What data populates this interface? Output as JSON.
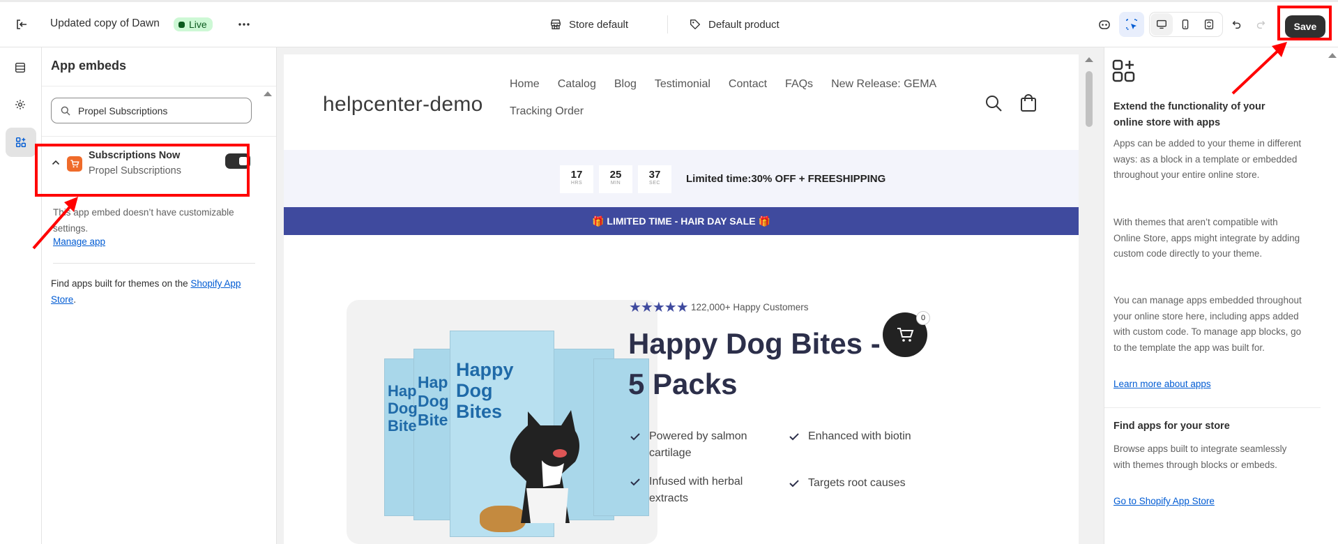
{
  "topbar": {
    "theme_name": "Updated copy of Dawn",
    "live_badge": "Live",
    "store_selector": "Store default",
    "template_selector": "Default product",
    "save_label": "Save"
  },
  "panel": {
    "title": "App embeds",
    "search_value": "Propel Subscriptions",
    "app": {
      "name": "Subscriptions Now",
      "subtitle": "Propel Subscriptions",
      "enabled": true,
      "note": "This app embed doesn’t have customizable settings.",
      "manage_link": "Manage app"
    },
    "footer_text": "Find apps built for themes on the ",
    "footer_link": "Shopify App Store",
    "footer_end": "."
  },
  "store": {
    "logo": "helpcenter-demo",
    "nav": [
      "Home",
      "Catalog",
      "Blog",
      "Testimonial",
      "Contact",
      "FAQs",
      "New Release: GEMA",
      "Tracking Order"
    ],
    "countdown": [
      {
        "value": "17",
        "unit": "HRS"
      },
      {
        "value": "25",
        "unit": "MIN"
      },
      {
        "value": "37",
        "unit": "SEC"
      }
    ],
    "promo_text": "Limited time:30% OFF + FREESHIPPING",
    "sale_banner": "🎁 LIMITED TIME - HAIR DAY SALE 🎁",
    "banner_color": "#3f4a9e",
    "stars": "★★★★★",
    "rating_text": "122,000+ Happy Customers",
    "product_title": "Happy Dog Bites - 5 Packs",
    "features": [
      "Powered by salmon cartilage",
      "Enhanced with biotin",
      "Infused with herbal extracts",
      "Targets root causes"
    ],
    "cart_count": "0",
    "package_text": "Happy Dog Bites",
    "package_text_short": "Hap Dog Bite"
  },
  "rpanel": {
    "heading": "Extend the functionality of your online store with apps",
    "p1": "Apps can be added to your theme in different ways: as a block in a template or embedded throughout your entire online store.",
    "p2": "With themes that aren’t compatible with Online Store, apps might integrate by adding custom code directly to your theme.",
    "p3": "You can manage apps embedded throughout your online store here, including apps added with custom code. To manage app blocks, go to the template the app was built for.",
    "learn_link": "Learn more about apps",
    "find_heading": "Find apps for your store",
    "find_text": "Browse apps built to integrate seamlessly with themes through blocks or embeds.",
    "store_link": "Go to Shopify App Store"
  }
}
